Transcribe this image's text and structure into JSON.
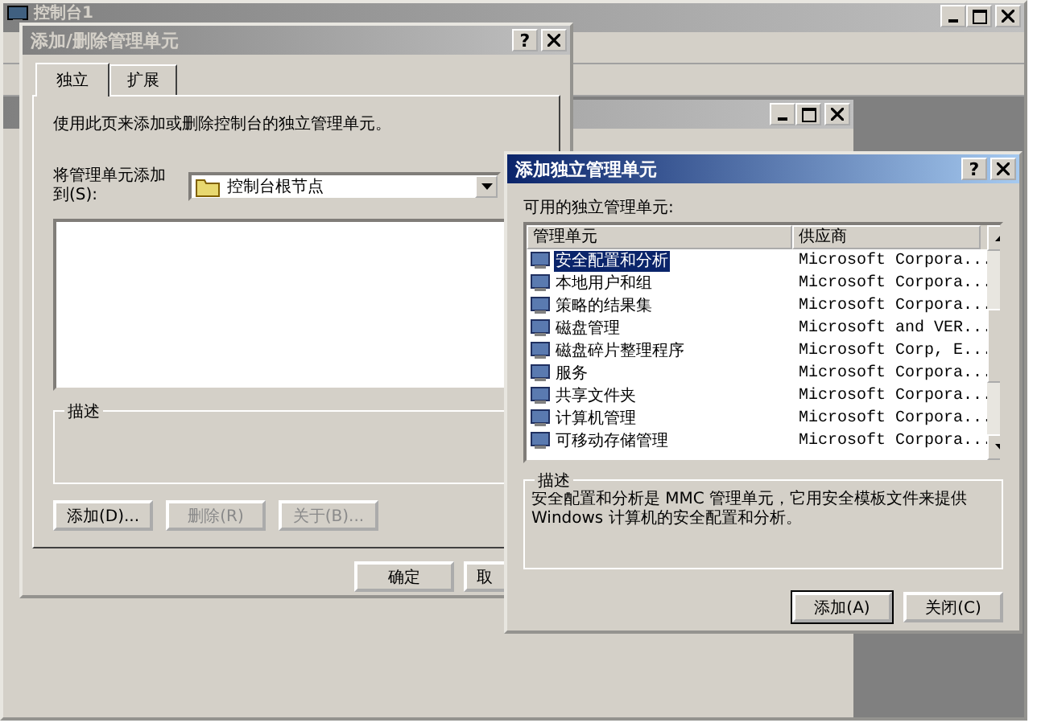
{
  "console_window": {
    "title": "控制台1"
  },
  "add_remove_dialog": {
    "title": "添加/删除管理单元",
    "help_glyph": "?",
    "tabs": [
      {
        "label": "独立",
        "selected": true
      },
      {
        "label": "扩展",
        "selected": false
      }
    ],
    "intro": "使用此页来添加或删除控制台的独立管理单元。",
    "add_to_label": "将管理单元添加到(S):",
    "add_to_value": "控制台根节点",
    "description_label": "描述",
    "buttons": [
      {
        "label": "添加(D)...",
        "disabled": false
      },
      {
        "label": "删除(R)",
        "disabled": true
      },
      {
        "label": "关于(B)...",
        "disabled": true
      }
    ],
    "footer_buttons": [
      "确定",
      "取"
    ]
  },
  "add_snapin_dialog": {
    "title": "添加独立管理单元",
    "help_glyph": "?",
    "list_label": "可用的独立管理单元:",
    "columns": [
      "管理单元",
      "供应商"
    ],
    "rows": [
      {
        "name": "安全配置和分析",
        "vendor": "Microsoft Corpora...",
        "selected": true
      },
      {
        "name": "本地用户和组",
        "vendor": "Microsoft Corpora...",
        "selected": false
      },
      {
        "name": "策略的结果集",
        "vendor": "Microsoft Corpora...",
        "selected": false
      },
      {
        "name": "磁盘管理",
        "vendor": "Microsoft and VER...",
        "selected": false
      },
      {
        "name": "磁盘碎片整理程序",
        "vendor": "Microsoft Corp, E...",
        "selected": false
      },
      {
        "name": "服务",
        "vendor": "Microsoft Corpora...",
        "selected": false
      },
      {
        "name": "共享文件夹",
        "vendor": "Microsoft Corpora...",
        "selected": false
      },
      {
        "name": "计算机管理",
        "vendor": "Microsoft Corpora...",
        "selected": false
      },
      {
        "name": "可移动存储管理",
        "vendor": "Microsoft Corpora...",
        "selected": false
      }
    ],
    "description_label": "描述",
    "description": "安全配置和分析是 MMC 管理单元，它用安全模板文件来提供 Windows 计算机的安全配置和分析。",
    "buttons": [
      {
        "label": "添加(A)",
        "default": true
      },
      {
        "label": "关闭(C)",
        "default": false
      }
    ]
  }
}
